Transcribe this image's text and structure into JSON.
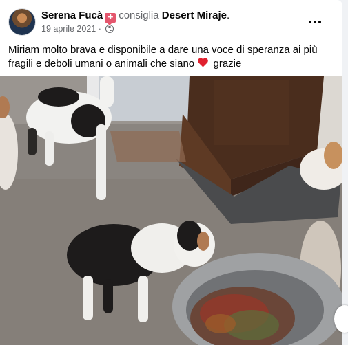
{
  "post": {
    "author": "Serena Fucà",
    "action": "consiglia",
    "page": "Desert Miraje",
    "punct": ".",
    "date": "19 aprile 2021",
    "separator": "·",
    "audience_icon": "globe-icon",
    "text_before_heart": "Miriam molto brava e disponibile a dare una voce di speranza ai più fragili e deboli umani o animali che siano",
    "text_after_heart": "grazie",
    "more_icon": "more-dots-icon",
    "badge_icon": "recommend-icon"
  },
  "photo": {
    "subject": "dogs-eating-photo"
  }
}
